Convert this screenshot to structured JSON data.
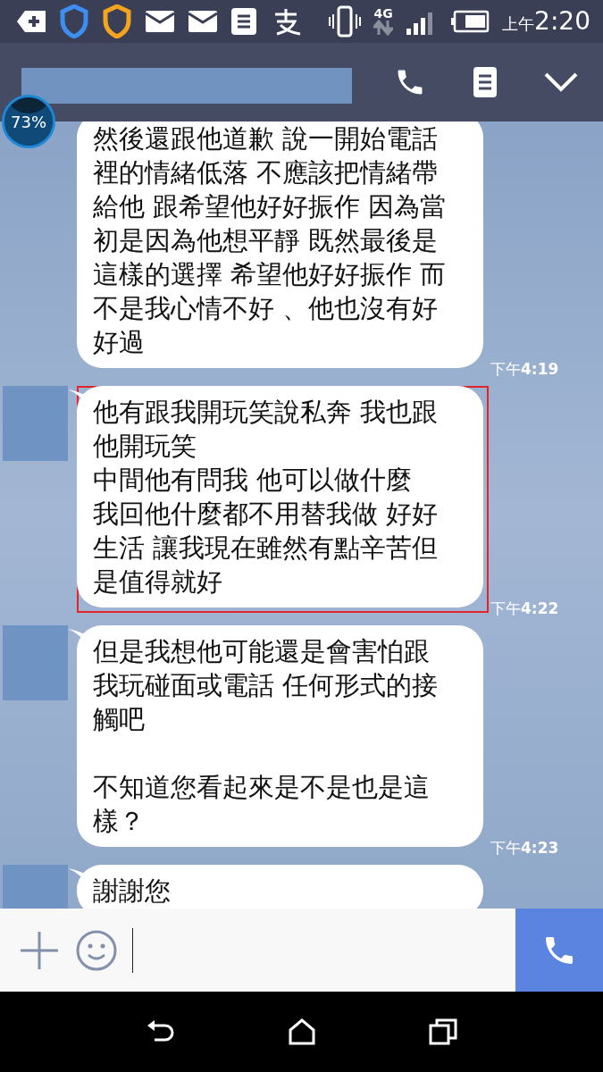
{
  "status_bar": {
    "network": "4G",
    "period": "上午",
    "time": "2:20"
  },
  "widget": {
    "text": "73%"
  },
  "messages": [
    {
      "paragraphs": [
        "然後還跟他道歉 說一開始電話裡的情緒低落 不應該把情緒帶給他 跟希望他好好振作 因為當初是因為他想平靜 既然最後是這樣的選擇 希望他好好振作 而不是我心情不好 、他也沒有好好過"
      ],
      "time": "下午**4:19**",
      "avatar": false,
      "highlighted": false
    },
    {
      "paragraphs": [
        "他有跟我開玩笑說私奔 我也跟他開玩笑",
        "中間他有問我 他可以做什麼",
        "我回他什麼都不用替我做 好好生活 讓我現在雖然有點辛苦但是值得就好"
      ],
      "time": "下午**4:22**",
      "kind": "lines",
      "avatar": true,
      "highlighted": true
    },
    {
      "paragraphs": [
        "但是我想他可能還是會害怕跟我玩碰面或電話 任何形式的接觸吧",
        "不知道您看起來是不是也是這樣？"
      ],
      "time": "下午**4:23**",
      "kind": "blank_line",
      "avatar": true,
      "highlighted": false
    },
    {
      "paragraphs": [
        "謝謝您"
      ],
      "avatar": true,
      "highlighted": false
    }
  ]
}
